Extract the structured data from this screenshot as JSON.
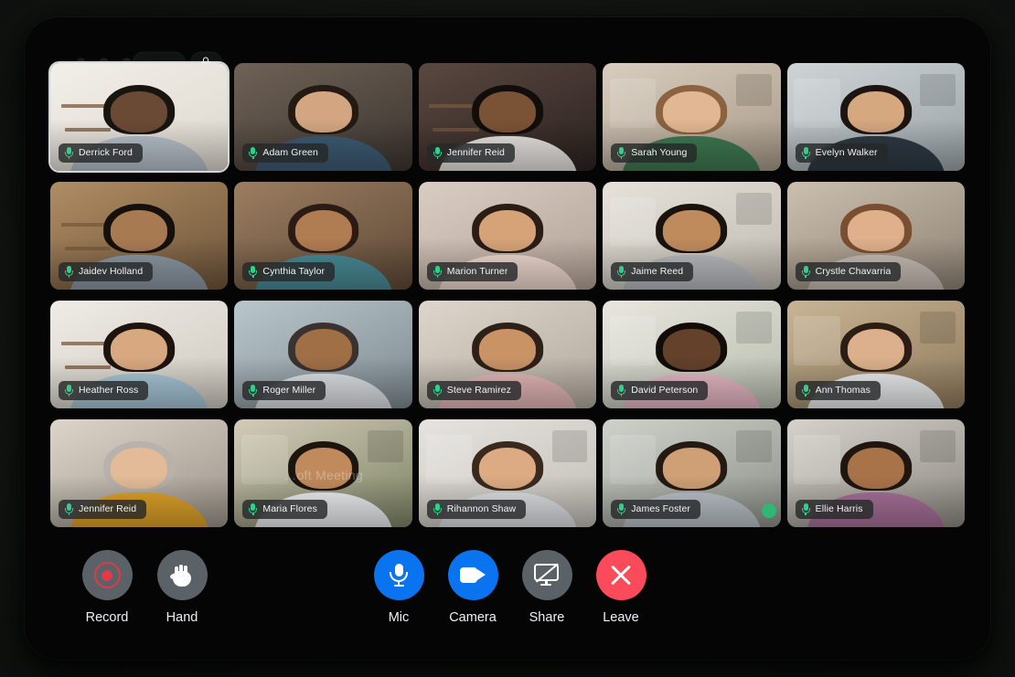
{
  "window": {
    "titlebar": {
      "traffic_lights": [
        "close",
        "minimize",
        "maximize"
      ],
      "pill_label": "",
      "lock_icon": "lock-icon"
    }
  },
  "grid": {
    "columns": 5,
    "rows": 4,
    "participants": [
      {
        "name": "Derrick Ford",
        "mic": "mic-on",
        "active_speaker": true,
        "skin": "#6b4a35",
        "hair": "#181410",
        "shirt": "#b9c3cc",
        "bg1": "#f2efe9",
        "bg2": "#ded8ce",
        "deco": "shelf"
      },
      {
        "name": "Adam Green",
        "mic": "mic-on",
        "active_speaker": false,
        "skin": "#d3a681",
        "hair": "#241a13",
        "shirt": "#3e5c74",
        "bg1": "#6f6257",
        "bg2": "#3c352f",
        "deco": "none"
      },
      {
        "name": "Jennifer Reid",
        "mic": "mic-on",
        "active_speaker": false,
        "skin": "#7a5236",
        "hair": "#120d0a",
        "shirt": "#e9e6e2",
        "bg1": "#5a4740",
        "bg2": "#2c2320",
        "deco": "shelf"
      },
      {
        "name": "Sarah Young",
        "mic": "mic-on",
        "active_speaker": false,
        "skin": "#e2b793",
        "hair": "#8c6240",
        "shirt": "#3f7a52",
        "bg1": "#d8cdbe",
        "bg2": "#a89a88",
        "deco": "panel"
      },
      {
        "name": "Evelyn Walker",
        "mic": "mic-on",
        "active_speaker": false,
        "skin": "#d5a87f",
        "hair": "#1b1410",
        "shirt": "#2f3a44",
        "bg1": "#cfd4d6",
        "bg2": "#9aa3a8",
        "deco": "panel"
      },
      {
        "name": "Jaidev Holland",
        "mic": "mic-on",
        "active_speaker": false,
        "skin": "#a87a52",
        "hair": "#15100c",
        "shirt": "#8d99a4",
        "bg1": "#b08d63",
        "bg2": "#6d543a",
        "deco": "shelf"
      },
      {
        "name": "Cynthia Taylor",
        "mic": "mic-on",
        "active_speaker": false,
        "skin": "#b07c52",
        "hair": "#2a1c14",
        "shirt": "#4a8b96",
        "bg1": "#9c7d61",
        "bg2": "#5d4936",
        "deco": "none"
      },
      {
        "name": "Marion Turner",
        "mic": "mic-on",
        "active_speaker": false,
        "skin": "#d6a379",
        "hair": "#2b1d15",
        "shirt": "#f1dcd2",
        "bg1": "#d9cdc3",
        "bg2": "#b3a296",
        "deco": "none"
      },
      {
        "name": "Jaime Reed",
        "mic": "mic-on",
        "active_speaker": false,
        "skin": "#c08b5c",
        "hair": "#1a120c",
        "shirt": "#b9bcc0",
        "bg1": "#e6e2da",
        "bg2": "#c0bbb1",
        "deco": "panel"
      },
      {
        "name": "Crystle Chavarria",
        "mic": "mic-on",
        "active_speaker": false,
        "skin": "#e0b08c",
        "hair": "#7a4f31",
        "shirt": "#c9bfb6",
        "bg1": "#cbbfae",
        "bg2": "#8e8274",
        "deco": "none"
      },
      {
        "name": "Heather Ross",
        "mic": "mic-on",
        "active_speaker": false,
        "skin": "#d8a881",
        "hair": "#1d1410",
        "shirt": "#a9c7d8",
        "bg1": "#efece6",
        "bg2": "#cfc9bf",
        "deco": "shelf"
      },
      {
        "name": "Roger Miller",
        "mic": "mic-on",
        "active_speaker": false,
        "skin": "#a06f46",
        "hair": "#3a3230",
        "shirt": "#dfe3e6",
        "bg1": "#b9c6cc",
        "bg2": "#7e8a90",
        "deco": "none"
      },
      {
        "name": "Steve Ramirez",
        "mic": "mic-on",
        "active_speaker": false,
        "skin": "#c99366",
        "hair": "#2d2018",
        "shirt": "#e5b8b8",
        "bg1": "#ddd6cc",
        "bg2": "#b2a99d",
        "deco": "none"
      },
      {
        "name": "David Peterson",
        "mic": "mic-on",
        "active_speaker": false,
        "skin": "#63412b",
        "hair": "#120c08",
        "shirt": "#e8b8c6",
        "bg1": "#e9e6de",
        "bg2": "#b7bdae",
        "deco": "panel"
      },
      {
        "name": "Ann Thomas",
        "mic": "mic-on",
        "active_speaker": false,
        "skin": "#dcb08c",
        "hair": "#2b1d14",
        "shirt": "#eceef0",
        "bg1": "#c9b595",
        "bg2": "#8f7a5c",
        "deco": "panel"
      },
      {
        "name": "Jennifer Reid",
        "mic": "mic-on",
        "active_speaker": false,
        "skin": "#e3bb98",
        "hair": "#b9b2ab",
        "shirt": "#e0a42a",
        "bg1": "#dcd5ca",
        "bg2": "#9c948a",
        "deco": "none"
      },
      {
        "name": "Maria Flores",
        "mic": "mic-on",
        "active_speaker": false,
        "skin": "#c08a5c",
        "hair": "#1d140e",
        "shirt": "#eef0f2",
        "bg1": "#d3cbb9",
        "bg2": "#7d8464",
        "deco": "panel",
        "watermark": "…oft Meeting"
      },
      {
        "name": "Rihannon Shaw",
        "mic": "mic-on",
        "active_speaker": false,
        "skin": "#dcab83",
        "hair": "#3a2a1e",
        "shirt": "#dfe2e6",
        "bg1": "#e6e4e0",
        "bg2": "#c2bdb6",
        "deco": "panel"
      },
      {
        "name": "James Foster",
        "mic": "mic-on",
        "active_speaker": false,
        "skin": "#cf9f76",
        "hair": "#241a13",
        "shirt": "#bcc3c9",
        "bg1": "#cfd2cb",
        "bg2": "#8d9189",
        "deco": "panel",
        "status_dot": "#2eb872"
      },
      {
        "name": "Ellie Harris",
        "mic": "mic-on",
        "active_speaker": false,
        "skin": "#a9734a",
        "hair": "#20160f",
        "shirt": "#a8719a",
        "bg1": "#d6d2cb",
        "bg2": "#8e8a83",
        "deco": "panel"
      }
    ]
  },
  "toolbar": {
    "left_controls": [
      {
        "label": "Record",
        "icon": "record-icon",
        "style": "gray"
      },
      {
        "label": "Hand",
        "icon": "raise-hand-icon",
        "style": "gray"
      }
    ],
    "center_controls": [
      {
        "label": "Mic",
        "icon": "microphone-icon",
        "style": "blue"
      },
      {
        "label": "Camera",
        "icon": "video-camera-icon",
        "style": "blue"
      },
      {
        "label": "Share",
        "icon": "screen-share-off-icon",
        "style": "gray"
      },
      {
        "label": "Leave",
        "icon": "close-x-icon",
        "style": "red"
      }
    ]
  },
  "colors": {
    "accent_blue": "#0a74f0",
    "danger_red": "#fb4b5b",
    "neutral_gray": "#5a6167",
    "mic_green": "#2fd18a",
    "record_red": "#e03a4a",
    "window_bg": "#050505"
  }
}
